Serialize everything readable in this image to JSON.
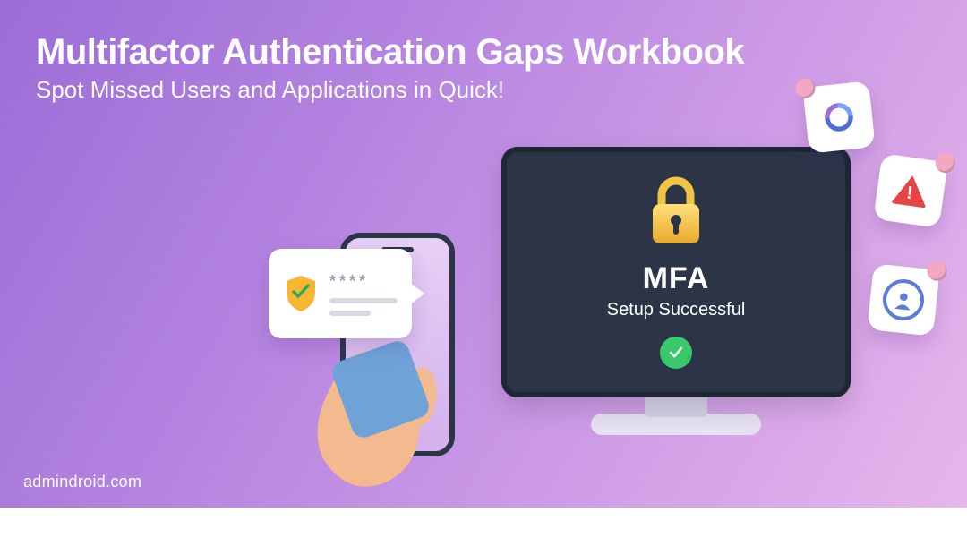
{
  "heading": {
    "title": "Multifactor Authentication Gaps Workbook",
    "subtitle": "Spot Missed Users and Applications in Quick!"
  },
  "monitor": {
    "title": "MFA",
    "subtitle": "Setup Successful"
  },
  "bubble": {
    "masked": "****"
  },
  "brand": "admindroid.com"
}
